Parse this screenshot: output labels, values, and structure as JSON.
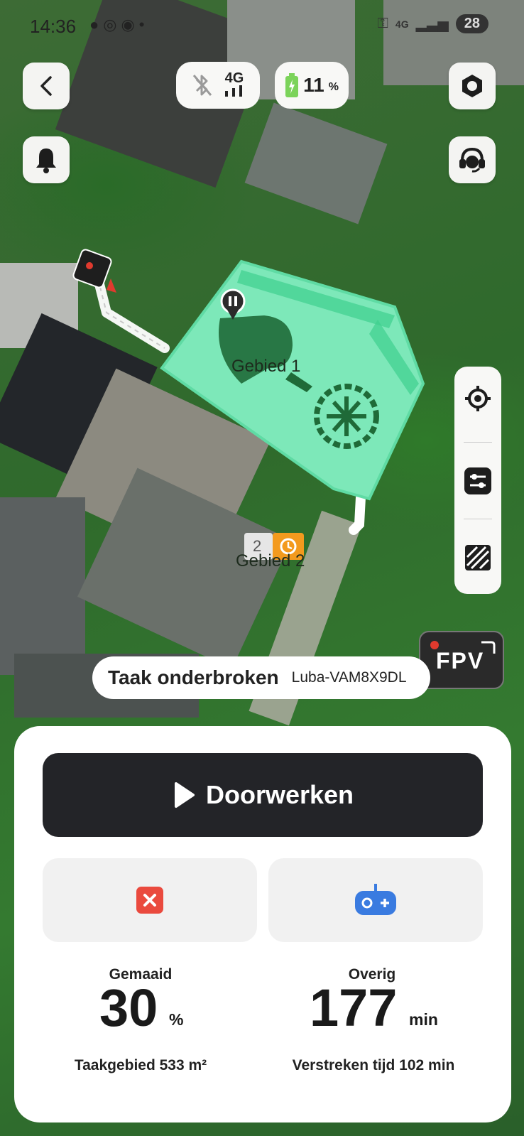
{
  "status_bar": {
    "time": "14:36",
    "network": "4G",
    "battery": "28"
  },
  "connection": {
    "network_label": "4G"
  },
  "battery": {
    "value": "11",
    "unit": "%"
  },
  "map": {
    "zone1_label": "Gebied 1",
    "zone2_label": "Gebied 2",
    "zone2_index": "2"
  },
  "fpv": {
    "label": "FPV"
  },
  "task_status": {
    "text": "Taak onderbroken",
    "device": "Luba-VAM8X9DL"
  },
  "panel": {
    "resume_label": "Doorwerken",
    "mowed": {
      "label": "Gemaaid",
      "value": "30",
      "unit": "%",
      "sub": "Taakgebied 533 m²"
    },
    "remaining": {
      "label": "Overig",
      "value": "177",
      "unit": "min",
      "sub": "Verstreken tijd 102 min"
    }
  },
  "colors": {
    "zone_fill": "#7de8b9",
    "zone_stroke": "#5fdba4",
    "stop_red": "#ea4a3e",
    "remote_blue": "#3a7be0",
    "dark_button": "#232428"
  }
}
